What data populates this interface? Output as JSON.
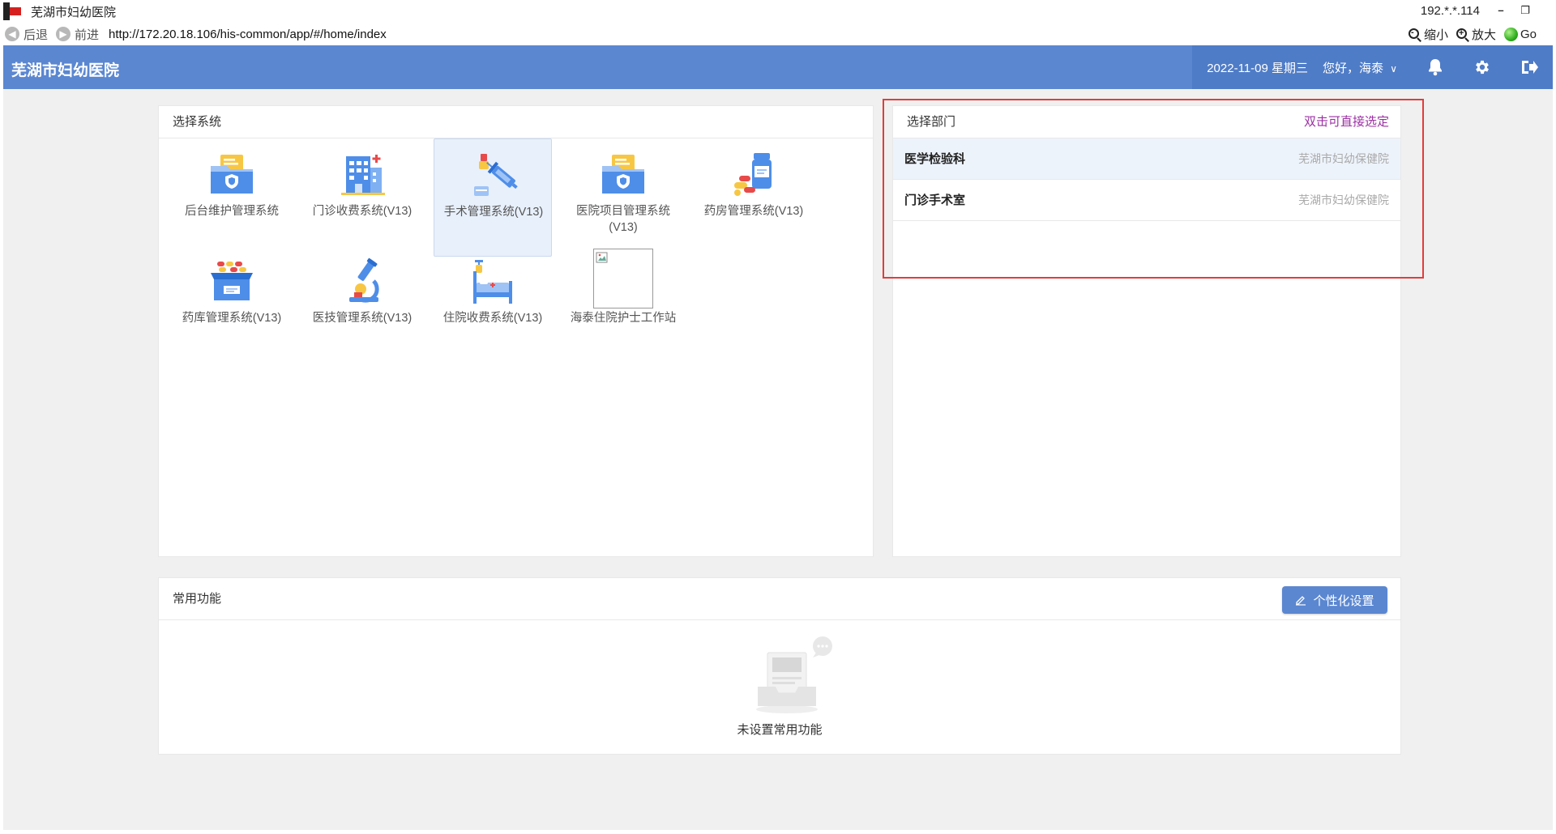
{
  "window": {
    "title": "芜湖市妇幼医院",
    "ip": "192.*.*.114",
    "minimize": "–",
    "restore": "❐",
    "close": "✕"
  },
  "browser": {
    "back_label": "后退",
    "forward_label": "前进",
    "url": "http://172.20.18.106/his-common/app/#/home/index",
    "zoom_out_label": "缩小",
    "zoom_in_label": "放大",
    "go_label": "Go"
  },
  "header": {
    "brand": "芜湖市妇幼医院",
    "date": "2022-11-09 星期三",
    "greeting": "您好，海泰",
    "user_chevron": "∨"
  },
  "systems": {
    "title": "选择系统",
    "items": [
      {
        "label": "后台维护管理系统",
        "icon": "folder-shield-icon"
      },
      {
        "label": "门诊收费系统(V13)",
        "icon": "hospital-building-icon"
      },
      {
        "label": "手术管理系统(V13)",
        "icon": "syringe-icon",
        "selected": true
      },
      {
        "label": "医院项目管理系统(V13)",
        "icon": "folder-shield-icon"
      },
      {
        "label": "药房管理系统(V13)",
        "icon": "medicine-bottle-icon"
      },
      {
        "label": "药库管理系统(V13)",
        "icon": "medicine-box-icon"
      },
      {
        "label": "医技管理系统(V13)",
        "icon": "microscope-icon"
      },
      {
        "label": "住院收费系统(V13)",
        "icon": "hospital-bed-icon"
      },
      {
        "label": "海泰住院护士工作站",
        "icon": "broken-image-icon"
      }
    ]
  },
  "departments": {
    "title": "选择部门",
    "hint": "双击可直接选定",
    "items": [
      {
        "name": "医学检验科",
        "org": "芜湖市妇幼保健院"
      },
      {
        "name": "门诊手术室",
        "org": "芜湖市妇幼保健院"
      }
    ]
  },
  "common": {
    "title": "常用功能",
    "personalize_label": "个性化设置",
    "empty_text": "未设置常用功能"
  },
  "colors": {
    "header_bg": "#5b87d1",
    "accent": "#5b87d1",
    "hint": "#9b2fa3",
    "highlight_box": "#e23c3c"
  }
}
